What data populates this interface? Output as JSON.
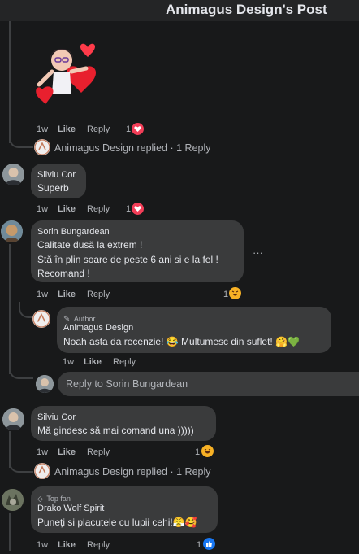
{
  "header": {
    "title": "Animagus Design's Post"
  },
  "reply_summary_1": {
    "name": "Animagus Design",
    "action": "replied",
    "sep": "·",
    "count": "1 Reply"
  },
  "reply_summary_2": {
    "name": "Animagus Design",
    "action": "replied",
    "sep": "·",
    "count": "1 Reply"
  },
  "sticker_row": {
    "time": "1w",
    "like": "Like",
    "reply": "Reply",
    "reactions": "1"
  },
  "comments": [
    {
      "name": "Silviu Cor",
      "text": "Superb",
      "time": "1w",
      "like": "Like",
      "reply": "Reply",
      "reactions": "1"
    },
    {
      "name": "Sorin Bungardean",
      "lines": [
        "Calitate dusă la extrem !",
        "Stă în plin soare de peste 6 ani si e la fel !",
        "Recomand !"
      ],
      "time": "1w",
      "like": "Like",
      "reply": "Reply",
      "reactions": "1",
      "more": "···"
    },
    {
      "badge": "Author",
      "name": "Animagus Design",
      "text": "Noah asta da recenzie! 😂 Multumesc din suflet! 🤗💚",
      "time": "1w",
      "like": "Like",
      "reply": "Reply"
    },
    {
      "name": "Silviu Cor",
      "text": "Mă gindesc să mai comand una )))))",
      "time": "1w",
      "like": "Like",
      "reply": "Reply",
      "reactions": "1"
    },
    {
      "badge": "Top fan",
      "name": "Drako Wolf Spirit",
      "text": "Puneți si placutele cu lupii cehi!😤🥰",
      "time": "1w",
      "like": "Like",
      "reply": "Reply",
      "reactions": "1"
    }
  ],
  "reply_input": {
    "placeholder": "Reply to Sorin Bungardean"
  },
  "colors": {
    "background": "#18191a",
    "bubble": "#3a3b3c",
    "heart": "#f33e58",
    "haha": "#f7b125",
    "like": "#1877f2"
  }
}
